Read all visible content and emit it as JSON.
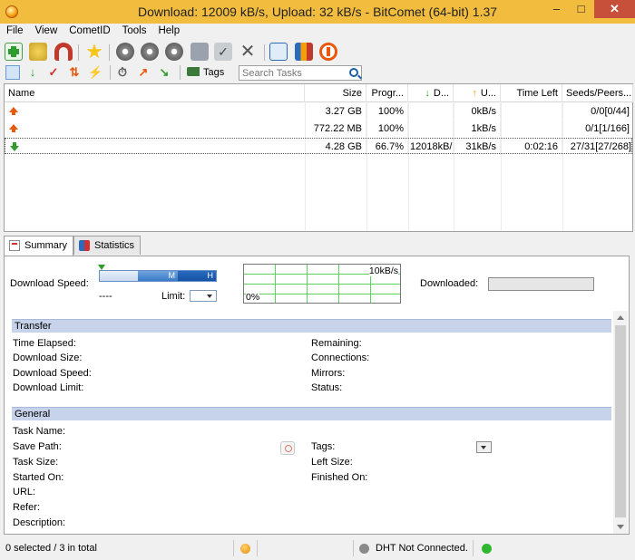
{
  "window": {
    "title": "Download: 12009 kB/s, Upload: 32 kB/s - BitComet (64-bit) 1.37"
  },
  "menu": [
    "File",
    "View",
    "CometID",
    "Tools",
    "Help"
  ],
  "toolbar2": {
    "tags_label": "Tags",
    "search_placeholder": "Search Tasks"
  },
  "columns": {
    "name": "Name",
    "size": "Size",
    "progress": "Progr...",
    "download": "D...",
    "upload": "U...",
    "time_left": "Time Left",
    "seeds": "Seeds/Peers..."
  },
  "tasks": [
    {
      "direction": "upload",
      "name": "",
      "size": "3.27 GB",
      "progress": "100%",
      "download": "",
      "upload": "0kB/s",
      "time_left": "",
      "seeds": "0/0[0/44]"
    },
    {
      "direction": "upload",
      "name": "",
      "size": "772.22 MB",
      "progress": "100%",
      "download": "",
      "upload": "1kB/s",
      "time_left": "",
      "seeds": "0/1[1/166]"
    },
    {
      "direction": "download",
      "name": "",
      "size": "4.28 GB",
      "progress": "66.7%",
      "download": "12018kB/s",
      "upload": "31kB/s",
      "time_left": "0:02:16",
      "seeds": "27/31[27/268]"
    }
  ],
  "tabs": {
    "summary": "Summary",
    "statistics": "Statistics"
  },
  "summary": {
    "download_speed_label": "Download Speed:",
    "speed_value": "----",
    "limit_label": "Limit:",
    "speed_bar": {
      "mid": "M",
      "high": "H"
    },
    "graph": {
      "max": "10kB/s",
      "min": "0%"
    },
    "downloaded_label": "Downloaded:",
    "transfer": {
      "header": "Transfer",
      "time_elapsed": "Time Elapsed:",
      "download_size": "Download Size:",
      "download_speed": "Download Speed:",
      "download_limit": "Download Limit:",
      "remaining": "Remaining:",
      "connections": "Connections:",
      "mirrors": "Mirrors:",
      "status": "Status:"
    },
    "general": {
      "header": "General",
      "task_name": "Task Name:",
      "save_path": "Save Path:",
      "task_size": "Task Size:",
      "started_on": "Started On:",
      "url": "URL:",
      "refer": "Refer:",
      "description": "Description:",
      "tags": "Tags:",
      "left_size": "Left Size:",
      "finished_on": "Finished On:"
    }
  },
  "status": {
    "selection": "0 selected / 3 in total",
    "dht": "DHT Not Connected."
  },
  "colors": {
    "titlebar": "#f2bd3f",
    "section": "#c6d3ea",
    "download_arrow": "#2e9d2e",
    "upload_arrow": "#e8590c",
    "status_ok": "#2fb82f"
  }
}
